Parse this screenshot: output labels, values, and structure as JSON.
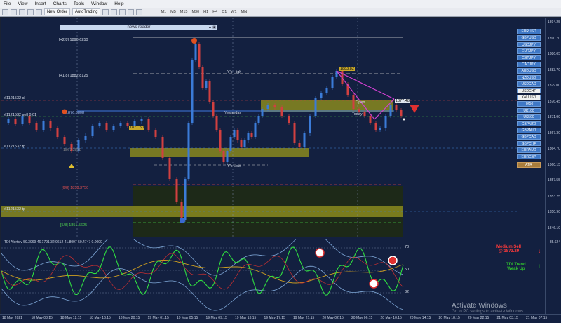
{
  "menu": [
    "File",
    "View",
    "Insert",
    "Charts",
    "Tools",
    "Window",
    "Help"
  ],
  "toolbar": {
    "new_order": "New Order",
    "autotrading": "AutoTrading"
  },
  "timeframes": [
    "M1",
    "M5",
    "M15",
    "M30",
    "H1",
    "H4",
    "D1",
    "W1",
    "MN"
  ],
  "news_reader": "news reader",
  "levels": {
    "l28": "[+2/8]  1890.6250",
    "l18": "[+1/8]  1882.8125",
    "yhigh": "Y's High",
    "yesterday": "Yesterday",
    "today": "Today",
    "open": "Open",
    "ylow": "Y's Low",
    "l68": "[6/8]  1858.3750",
    "l58": "[5/8]  1851.5625",
    "tag1": "#1121532 sl",
    "tag2": "#1121532 sell 0.01",
    "tag3": "#1121532 tp",
    "tag4": "#1121532 tp",
    "val1": "1876.0808",
    "box1": "1871.50",
    "box2": "1883.82",
    "box3": "1877.48",
    "pivot": "1867.3830"
  },
  "yaxis": [
    "1894.25",
    "1890.70",
    "1886.05",
    "1883.70",
    "1879.00",
    "1876.45",
    "1871.90",
    "1867.30",
    "1864.70",
    "1860.15",
    "1857.55",
    "1853.25",
    "1850.90",
    "1846.10"
  ],
  "symbols": [
    "EURUSD",
    "GBPUSD",
    "USDJPY",
    "EURJPY",
    "GBPJPY",
    "CADJPY",
    "AUDUSD",
    "NZDUSD",
    "USDCAD",
    "USDCHF",
    "XAUUSD",
    "HK50",
    "UK100",
    "US500",
    "GBPNZD",
    "GBPAUD",
    "GBPCAD",
    "GBPCHF",
    "EURAUD",
    "EURGBP"
  ],
  "atr": "ATR",
  "indicator": {
    "title": "TDI Alerts v 59.3969 46.1791 32.9612 41.8097 50.4747 0.0000",
    "ticks": [
      "70",
      "50",
      "32"
    ],
    "signal_label": "Medium Sell",
    "signal_price": "@ 1873.29",
    "trend_label": "TDI Trend",
    "trend_value": "Weak Up",
    "right_val": "85.624"
  },
  "time_labels": [
    "18 May 2021",
    "18 May 08:15",
    "18 May 12:15",
    "18 May 16:15",
    "18 May 20:15",
    "19 May 01:15",
    "19 May 05:15",
    "19 May 09:15",
    "19 May 13:15",
    "19 May 17:15",
    "19 May 21:15",
    "20 May 02:15",
    "20 May 06:15",
    "20 May 10:15",
    "20 May 14:15",
    "20 May 18:15",
    "20 May 22:15",
    "21 May 03:15",
    "21 May 07:15"
  ],
  "windows": {
    "activate": "Activate Windows",
    "goto": "Go to PC settings to activate Windows."
  },
  "colors": {
    "bg": "#132040",
    "zone": "#8a8a1e",
    "bull": "#3b7bd8",
    "bear": "#d24040",
    "magenta": "#d040d0"
  }
}
